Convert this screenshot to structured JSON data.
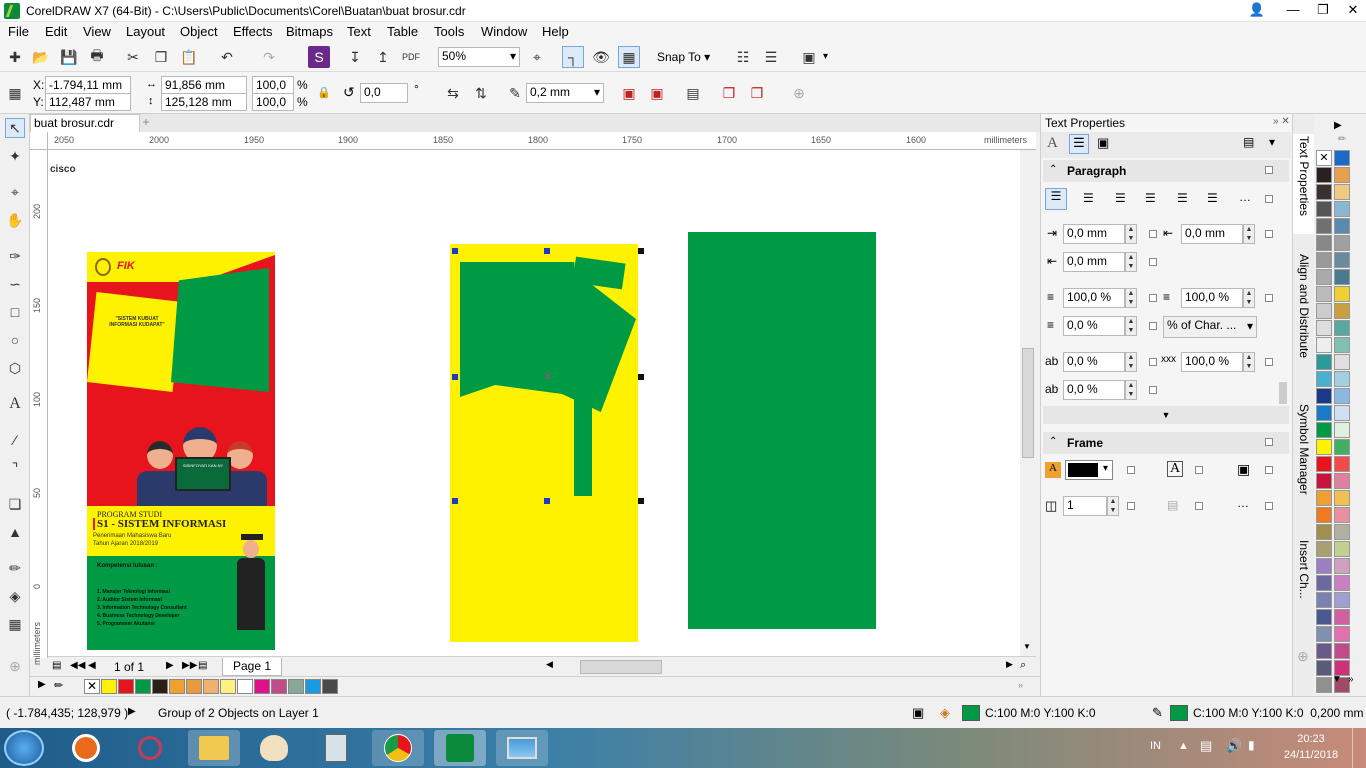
{
  "window": {
    "title": "CorelDRAW X7 (64-Bit) - C:\\Users\\Public\\Documents\\Corel\\Buatan\\buat brosur.cdr"
  },
  "menu": [
    "File",
    "Edit",
    "View",
    "Layout",
    "Object",
    "Effects",
    "Bitmaps",
    "Text",
    "Table",
    "Tools",
    "Window",
    "Help"
  ],
  "standard_toolbar": {
    "zoom": "50%",
    "snap_to": "Snap To"
  },
  "property_bar": {
    "x_label": "X:",
    "x": "-1.794,11 mm",
    "y_label": "Y:",
    "y": "112,487 mm",
    "width": "91,856 mm",
    "height": "125,128 mm",
    "scale_w": "100,0",
    "scale_h": "100,0",
    "pct": "%",
    "rotation": "0,0",
    "deg": "°",
    "outline_width": "0,2 mm"
  },
  "document": {
    "tab": "buat brosur.cdr"
  },
  "ruler": {
    "h_ticks": [
      "2050",
      "2000",
      "1950",
      "1900",
      "1850",
      "1800",
      "1750",
      "1700",
      "1650",
      "1600"
    ],
    "unit": "millimeters",
    "v_ticks": [
      "200",
      "150",
      "100",
      "50",
      "0"
    ]
  },
  "canvas": {
    "logo_text": "cisco",
    "brochure": {
      "badge_text": "\"SISTEM KUBUAT INFORMASI KUDAPAT\"",
      "screen_text": "SISINFOYATI KAN NY",
      "program": "PROGRAM STUDI",
      "major": "S1 - SISTEM INFORMASI",
      "admission": "Penerimaan Mahasiswa Baru",
      "year": "Tahun Ajaran 2018/2019",
      "competence_title": "Kompetensi lulusan :",
      "competences": [
        "1. Manajer Teknologi Informasi",
        "2. Auditor Sistem Informasi",
        "3. Information Technology Consultant",
        "4. Business Technology Developer",
        "5. Programmer Akutansi"
      ]
    }
  },
  "page_nav": {
    "page_of": "1 of 1",
    "page_tab": "Page 1"
  },
  "docker": {
    "title": "Text Properties",
    "paragraph": {
      "title": "Paragraph",
      "left_indent": "0,0 mm",
      "right_indent": "0,0 mm",
      "first_line": "0,0 mm",
      "line_spacing": "100,0 %",
      "para_spacing": "100,0 %",
      "before": "0,0 %",
      "spacing_unit": "% of Char. ...",
      "char_spacing": "0,0 %",
      "word_spacing": "100,0 %",
      "lang_spacing": "0,0 %"
    },
    "frame": {
      "title": "Frame",
      "columns": "1"
    }
  },
  "vertical_tabs": [
    "Text Properties",
    "Align and Distribute",
    "Symbol Manager",
    "Insert Ch..."
  ],
  "status": {
    "coords": "( -1.784,435; 128,979 )",
    "selection": "Group of 2 Objects on Layer 1",
    "fill": "C:100 M:0 Y:100 K:0",
    "outline": "C:100 M:0 Y:100 K:0  0,200 mm"
  },
  "taskbar": {
    "lang": "IN",
    "time": "20:23",
    "date": "24/11/2018"
  },
  "colors": {
    "green": "#009a44",
    "yellow": "#fff200",
    "red": "#e8141c",
    "accent": "#0a64c8"
  }
}
